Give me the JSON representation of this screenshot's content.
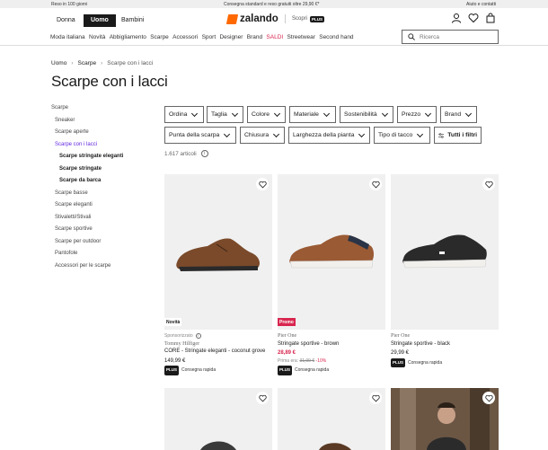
{
  "topbar": {
    "left": "Reso in 100 giorni",
    "center": "Consegna standard e reso gratuiti oltre 29,90 €*",
    "right": "Aiuto e contatti"
  },
  "header": {
    "genders": [
      "Donna",
      "Uomo",
      "Bambini"
    ],
    "logo": "zalando",
    "plus_link": "Scopri",
    "plus_badge": "PLUS",
    "nav": [
      "Moda italiana",
      "Novità",
      "Abbigliamento",
      "Scarpe",
      "Accessori",
      "Sport",
      "Designer",
      "Brand",
      "SALDI",
      "Streetwear",
      "Second hand"
    ],
    "search_placeholder": "Ricerca"
  },
  "breadcrumb": [
    "Uomo",
    "Scarpe",
    "Scarpe con i lacci"
  ],
  "page_title": "Scarpe con i lacci",
  "sidebar": {
    "items": [
      {
        "label": "Scarpe"
      },
      {
        "label": "Sneaker"
      },
      {
        "label": "Scarpe aperte"
      },
      {
        "label": "Scarpe con i lacci"
      },
      {
        "label": "Scarpe stringate eleganti"
      },
      {
        "label": "Scarpe stringate"
      },
      {
        "label": "Scarpe da barca"
      },
      {
        "label": "Scarpe basse"
      },
      {
        "label": "Scarpe eleganti"
      },
      {
        "label": "Stivaletti/Stivali"
      },
      {
        "label": "Scarpe sportive"
      },
      {
        "label": "Scarpe per outdoor"
      },
      {
        "label": "Pantofole"
      },
      {
        "label": "Accessori per le scarpe"
      }
    ]
  },
  "filters": {
    "row1": [
      "Ordina",
      "Taglia",
      "Colore",
      "Materiale",
      "Sostenibilità",
      "Prezzo",
      "Brand"
    ],
    "row2": [
      "Punta della scarpa",
      "Chiusura",
      "Larghezza della pianta",
      "Tipo di tacco"
    ],
    "all_filters": "Tutti i filtri"
  },
  "article_count": "1.617 articoli",
  "products": [
    {
      "badge": "Novità",
      "sponsored": "Sponsorizzato",
      "brand": "Tommy Hilfiger",
      "name": "CORE - Stringate eleganti - coconut grove",
      "price": "149,99 €",
      "plus": "PLUS",
      "shipping": "Consegna rapida"
    },
    {
      "badge": "Promo",
      "brand": "Pier One",
      "name": "Stringate sportive - brown",
      "price": "28,89 €",
      "old_price_label": "Prima era:",
      "old_price": "31,99 €",
      "discount": "-10%",
      "plus": "PLUS",
      "shipping": "Consegna rapida"
    },
    {
      "brand": "Pier One",
      "name": "Stringate sportive - black",
      "price": "29,99 €",
      "plus": "PLUS",
      "shipping": "Consegna rapida"
    }
  ],
  "colors": {
    "accent": "#ff6900",
    "sale": "#d8264f",
    "active": "#6328e0"
  }
}
